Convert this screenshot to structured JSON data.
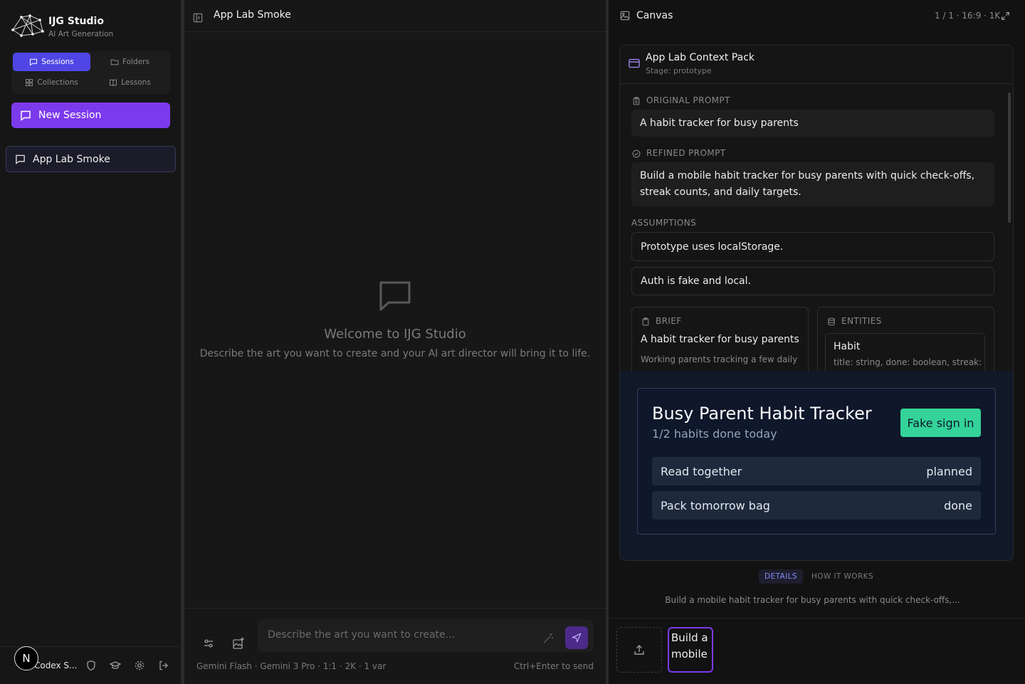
{
  "sidebar": {
    "brand_title": "IJG Studio",
    "brand_subtitle": "AI Art Generation",
    "tabs": [
      {
        "label": "Sessions",
        "icon": "chat-icon",
        "active": true
      },
      {
        "label": "Folders",
        "icon": "folder-icon",
        "active": false
      },
      {
        "label": "Collections",
        "icon": "grid-icon",
        "active": false
      },
      {
        "label": "Lessons",
        "icon": "book-icon",
        "active": false
      }
    ],
    "new_session_label": "New Session",
    "sessions": [
      {
        "label": "App Lab Smoke"
      }
    ],
    "user": {
      "avatar_letter": "N",
      "name": "Codex S..."
    }
  },
  "chat": {
    "title": "App Lab Smoke",
    "welcome_title": "Welcome to IJG Studio",
    "welcome_subtitle": "Describe the art you want to create and your AI art director will bring it to life.",
    "input_placeholder": "Describe the art you want to create...",
    "model_meta": "Gemini Flash · Gemini 3 Pro · 1:1 · 2K · 1 var",
    "send_hint": "Ctrl+Enter to send"
  },
  "canvas": {
    "title": "Canvas",
    "meta": "1 / 1 · 16:9 · 1K",
    "context_pack": {
      "title": "App Lab Context Pack",
      "stage": "Stage: prototype",
      "original_prompt_label": "ORIGINAL PROMPT",
      "original_prompt": "A habit tracker for busy parents",
      "refined_prompt_label": "REFINED PROMPT",
      "refined_prompt": "Build a mobile habit tracker for busy parents with quick check-offs, streak counts, and daily targets.",
      "assumptions_label": "ASSUMPTIONS",
      "assumptions": [
        "Prototype uses localStorage.",
        "Auth is fake and local."
      ],
      "brief_label": "BRIEF",
      "brief_title": "A habit tracker for busy parents",
      "brief_text": "Working parents tracking a few daily",
      "entities_label": "ENTITIES",
      "entity_name": "Habit",
      "entity_fields": "title: string, done: boolean, streak:"
    },
    "app_preview": {
      "title": "Busy Parent Habit Tracker",
      "subtitle": "1/2 habits done today",
      "sign_in_label": "Fake sign in",
      "habits": [
        {
          "name": "Read together",
          "status": "planned"
        },
        {
          "name": "Pack tomorrow bag",
          "status": "done"
        }
      ],
      "colors": {
        "bg": "#0f172a",
        "row": "#1e293b",
        "accent": "#34d399"
      }
    },
    "tabs": [
      {
        "label": "DETAILS",
        "active": true
      },
      {
        "label": "HOW IT WORKS",
        "active": false
      }
    ],
    "caption": "Build a mobile habit tracker for busy parents with quick check-offs,...",
    "thumbnail_alt": "Build a mobile"
  },
  "colors": {
    "accent_purple": "#7c3aed",
    "accent_indigo": "#4f46e5",
    "background": "#121212"
  }
}
